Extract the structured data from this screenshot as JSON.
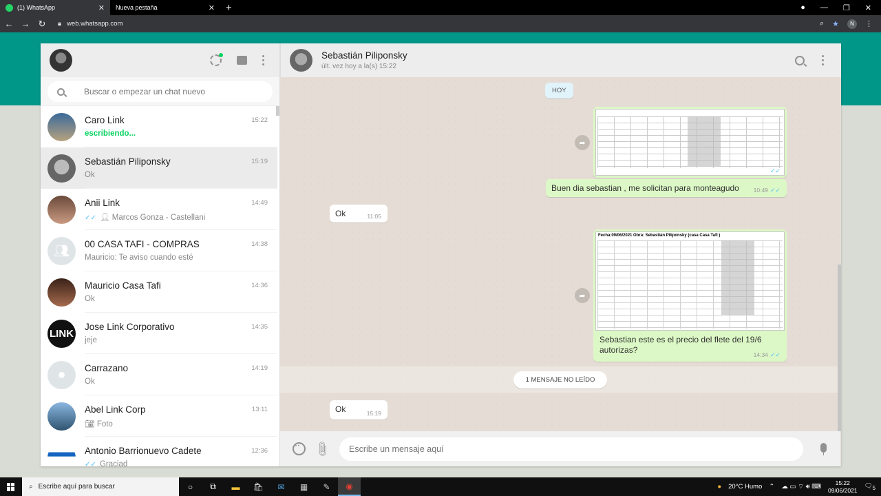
{
  "browser": {
    "tabs": [
      {
        "label": "(1) WhatsApp",
        "active": true
      },
      {
        "label": "Nueva pestaña",
        "active": false
      }
    ],
    "url": "web.whatsapp.com",
    "profile_initial": "N"
  },
  "sidebar": {
    "search_placeholder": "Buscar o empezar un chat nuevo",
    "chats": [
      {
        "name": "Caro Link",
        "time": "15:22",
        "preview": "escribiendo...",
        "typing": true
      },
      {
        "name": "Sebastián Piliponsky",
        "time": "15:19",
        "preview": "Ok",
        "selected": true
      },
      {
        "name": "Anii Link",
        "time": "14:49",
        "preview": "Marcos Gonza - Castellani",
        "ticks": "✓✓"
      },
      {
        "name": "00 CASA TAFI - COMPRAS",
        "time": "14:38",
        "preview": "Mauricio: Te aviso cuando esté"
      },
      {
        "name": "Mauricio Casa Tafi",
        "time": "14:36",
        "preview": "Ok"
      },
      {
        "name": "Jose Link Corporativo",
        "time": "14:35",
        "preview": "jeje"
      },
      {
        "name": "Carrazano",
        "time": "14:19",
        "preview": "Ok"
      },
      {
        "name": "Abel Link Corp",
        "time": "13:11",
        "preview": "Foto"
      },
      {
        "name": "Antonio Barrionuevo Cadete",
        "time": "12:36",
        "preview": "Graciad",
        "ticks": "✓✓"
      }
    ]
  },
  "conversation": {
    "contact_name": "Sebastián Piliponsky",
    "contact_status": "últ. vez hoy a la(s) 15:22",
    "day_label": "HOY",
    "messages": [
      {
        "type": "image",
        "direction": "out",
        "time": "10:49"
      },
      {
        "type": "text",
        "direction": "out",
        "text": "Buen dia sebastian , me solicitan para monteagudo",
        "time": "10:49"
      },
      {
        "type": "text",
        "direction": "in",
        "text": "Ok",
        "time": "11:05"
      },
      {
        "type": "image",
        "direction": "out",
        "sheet_title": "Fecha:09/06/2021    Obra: Sebastián Piliponsky (casa Casa Tafi )",
        "caption": "Sebastian este es el precio del flete del 19/6 autorizas?",
        "time": "14:34"
      },
      {
        "type": "text",
        "direction": "in",
        "text": "Ok",
        "time": "15:19"
      }
    ],
    "unread_label": "1 MENSAJE NO LEÍDO",
    "compose_placeholder": "Escribe un mensaje aquí"
  },
  "taskbar": {
    "search_placeholder": "Escribe aquí para buscar",
    "weather": "20°C  Humo",
    "time": "15:22",
    "date": "09/06/2021",
    "notifications": "5"
  },
  "colors": {
    "accent": "#009688",
    "out_bubble": "#dcf8c6",
    "typing": "#09d261",
    "read_ticks": "#4fc3f7"
  }
}
